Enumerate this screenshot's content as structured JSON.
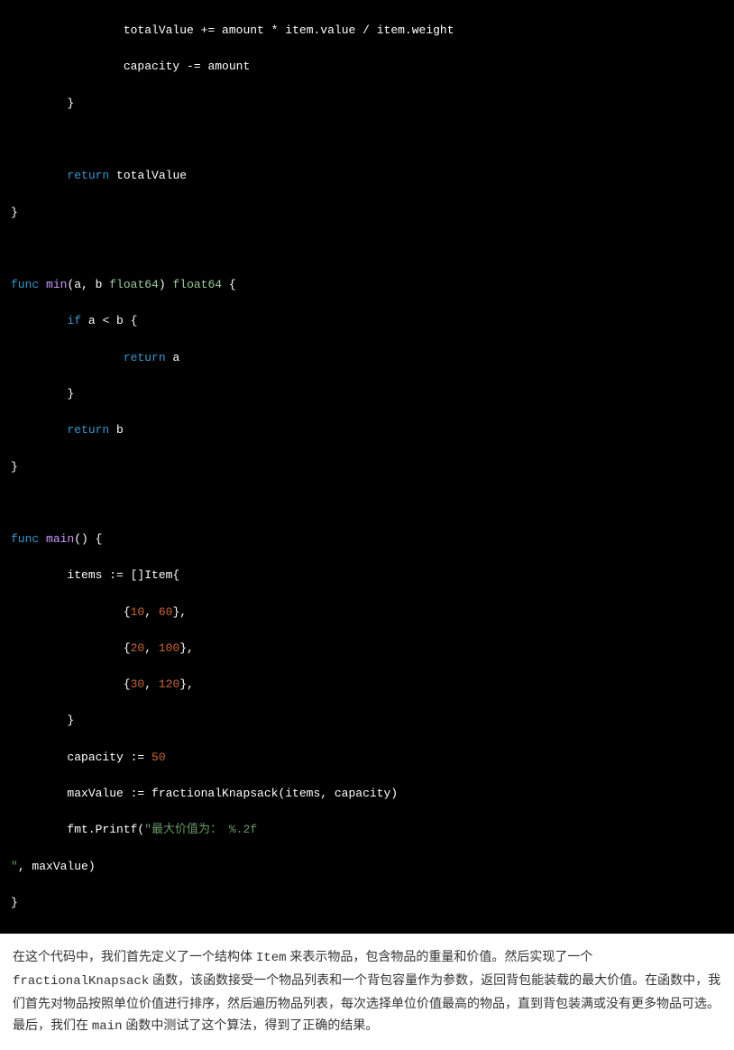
{
  "code": {
    "l1_a": "                totalValue ",
    "l1_b": "+=",
    "l1_c": " amount ",
    "l1_d": "*",
    "l1_e": " item.value ",
    "l1_f": "/",
    "l1_g": " item.weight",
    "l2_a": "                capacity ",
    "l2_b": "-=",
    "l2_c": " amount",
    "l3": "        }",
    "l4": "",
    "l5_a": "        ",
    "l5_b": "return",
    "l5_c": " totalValue",
    "l6": "}",
    "l7": "",
    "l8_a": "func",
    "l8_b": " ",
    "l8_c": "min",
    "l8_d": "(a, b ",
    "l8_e": "float64",
    "l8_f": ") ",
    "l8_g": "float64",
    "l8_h": " {",
    "l9_a": "        ",
    "l9_b": "if",
    "l9_c": " a ",
    "l9_d": "<",
    "l9_e": " b {",
    "l10_a": "                ",
    "l10_b": "return",
    "l10_c": " a",
    "l11": "        }",
    "l12_a": "        ",
    "l12_b": "return",
    "l12_c": " b",
    "l13": "}",
    "l14": "",
    "l15_a": "func",
    "l15_b": " ",
    "l15_c": "main",
    "l15_d": "() {",
    "l16": "        items := []Item{",
    "l17_a": "                {",
    "l17_b": "10",
    "l17_c": ", ",
    "l17_d": "60",
    "l17_e": "},",
    "l18_a": "                {",
    "l18_b": "20",
    "l18_c": ", ",
    "l18_d": "100",
    "l18_e": "},",
    "l19_a": "                {",
    "l19_b": "30",
    "l19_c": ", ",
    "l19_d": "120",
    "l19_e": "},",
    "l20": "        }",
    "l21_a": "        capacity := ",
    "l21_b": "50",
    "l22": "        maxValue := fractionalKnapsack(items, capacity)",
    "l23_a": "        fmt.Printf(",
    "l23_b": "\"最大价值为： %.2f",
    "l24_a": "\"",
    "l24_b": ", maxValue)",
    "l25": "}"
  },
  "paragraph": {
    "p1": "在这个代码中，我们首先定义了一个结构体 ",
    "c1": "Item",
    "p2": " 来表示物品，包含物品的重量和价值。然后实现了一个 ",
    "c2": "fractionalKnapsack",
    "p3": " 函数，该函数接受一个物品列表和一个背包容量作为参数，返回背包能装载的最大价值。在函数中，我们首先对物品按照单位价值进行排序，然后遍历物品列表，每次选择单位价值最高的物品，直到背包装满或没有更多物品可选。最后，我们在 ",
    "c3": "main",
    "p4": " 函数中测试了这个算法，得到了正确的结果。"
  }
}
